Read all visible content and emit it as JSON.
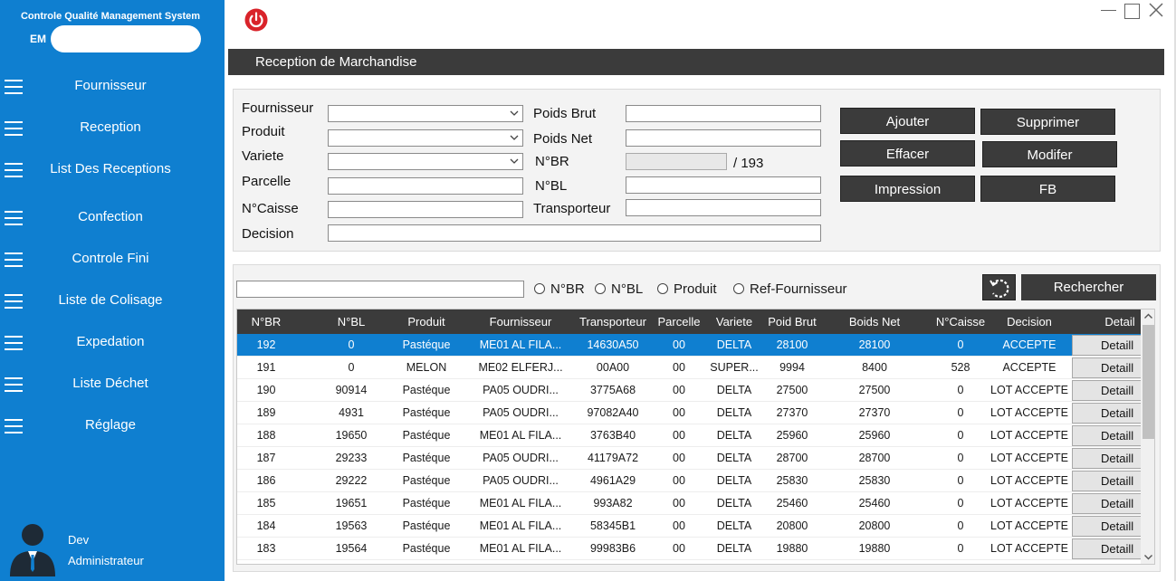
{
  "sidebar": {
    "app_title": "Controle Qualité Management System",
    "user_email_prefix": "EM",
    "items": [
      {
        "label": "Fournisseur"
      },
      {
        "label": "Reception"
      },
      {
        "label": "List Des Receptions"
      },
      {
        "label": "Confection"
      },
      {
        "label": "Controle Fini"
      },
      {
        "label": "Liste de Colisage"
      },
      {
        "label": "Expedation"
      },
      {
        "label": "Liste Déchet"
      },
      {
        "label": "Réglage"
      }
    ],
    "user": {
      "name": "Dev",
      "role": "Administrateur"
    }
  },
  "header": {
    "title": "Reception de Marchandise"
  },
  "form": {
    "fournisseur_label": "Fournisseur",
    "produit_label": "Produit",
    "variete_label": "Variete",
    "parcelle_label": "Parcelle",
    "ncaisse_label": "N°Caisse",
    "decision_label": "Decision",
    "poids_brut_label": "Poids Brut",
    "poids_net_label": "Poids Net",
    "nbr_label": "N°BR",
    "nbl_label": "N°BL",
    "transporteur_label": "Transporteur",
    "nbr_total": "/ 193"
  },
  "actions": {
    "ajouter": "Ajouter",
    "supprimer": "Supprimer",
    "effacer": "Effacer",
    "modifer": "Modifer",
    "impression": "Impression",
    "fb": "FB"
  },
  "search": {
    "options": [
      "N°BR",
      "N°BL",
      "Produit",
      "Ref-Fournisseur"
    ],
    "button": "Rechercher"
  },
  "table": {
    "columns": [
      "N°BR",
      "N°BL",
      "Produit",
      "Fournisseur",
      "Transporteur",
      "Parcelle",
      "Variete",
      "Poid Brut",
      "Boids Net",
      "N°Caisse",
      "Decision",
      "Detail"
    ],
    "detail_label": "Detaill",
    "rows": [
      [
        "192",
        "0",
        "Pastéque",
        "ME01 AL FILA...",
        "14630A50",
        "00",
        "DELTA",
        "28100",
        "28100",
        "0",
        "ACCEPTE"
      ],
      [
        "191",
        "0",
        "MELON",
        "ME02 ELFERJ...",
        "00A00",
        "00",
        "SUPER...",
        "9994",
        "8400",
        "528",
        "ACCEPTE"
      ],
      [
        "190",
        "90914",
        "Pastéque",
        "PA05 OUDRI...",
        "3775A68",
        "00",
        "DELTA",
        "27500",
        "27500",
        "0",
        "LOT ACCEPTE"
      ],
      [
        "189",
        "4931",
        "Pastéque",
        "PA05 OUDRI...",
        "97082A40",
        "00",
        "DELTA",
        "27370",
        "27370",
        "0",
        "LOT ACCEPTE"
      ],
      [
        "188",
        "19650",
        "Pastéque",
        "ME01 AL FILA...",
        "3763B40",
        "00",
        "DELTA",
        "25960",
        "25960",
        "0",
        "LOT ACCEPTE"
      ],
      [
        "187",
        "29233",
        "Pastéque",
        "PA05 OUDRI...",
        "41179A72",
        "00",
        "DELTA",
        "28700",
        "28700",
        "0",
        "LOT ACCEPTE"
      ],
      [
        "186",
        "29222",
        "Pastéque",
        "PA05 OUDRI...",
        "4961A29",
        "00",
        "DELTA",
        "25830",
        "25830",
        "0",
        "LOT ACCEPTE"
      ],
      [
        "185",
        "19651",
        "Pastéque",
        "ME01 AL FILA...",
        "993A82",
        "00",
        "DELTA",
        "25460",
        "25460",
        "0",
        "LOT ACCEPTE"
      ],
      [
        "184",
        "19563",
        "Pastéque",
        "ME01 AL FILA...",
        "58345B1",
        "00",
        "DELTA",
        "20800",
        "20800",
        "0",
        "LOT ACCEPTE"
      ],
      [
        "183",
        "19564",
        "Pastéque",
        "ME01 AL FILA...",
        "99983B6",
        "00",
        "DELTA",
        "19880",
        "19880",
        "0",
        "LOT ACCEPTE"
      ]
    ],
    "selected_row": 0
  },
  "colors": {
    "sidebar": "#0f7fd0",
    "header": "#3b3b3b",
    "selection": "#0f7fd0",
    "power": "#d9232a"
  }
}
